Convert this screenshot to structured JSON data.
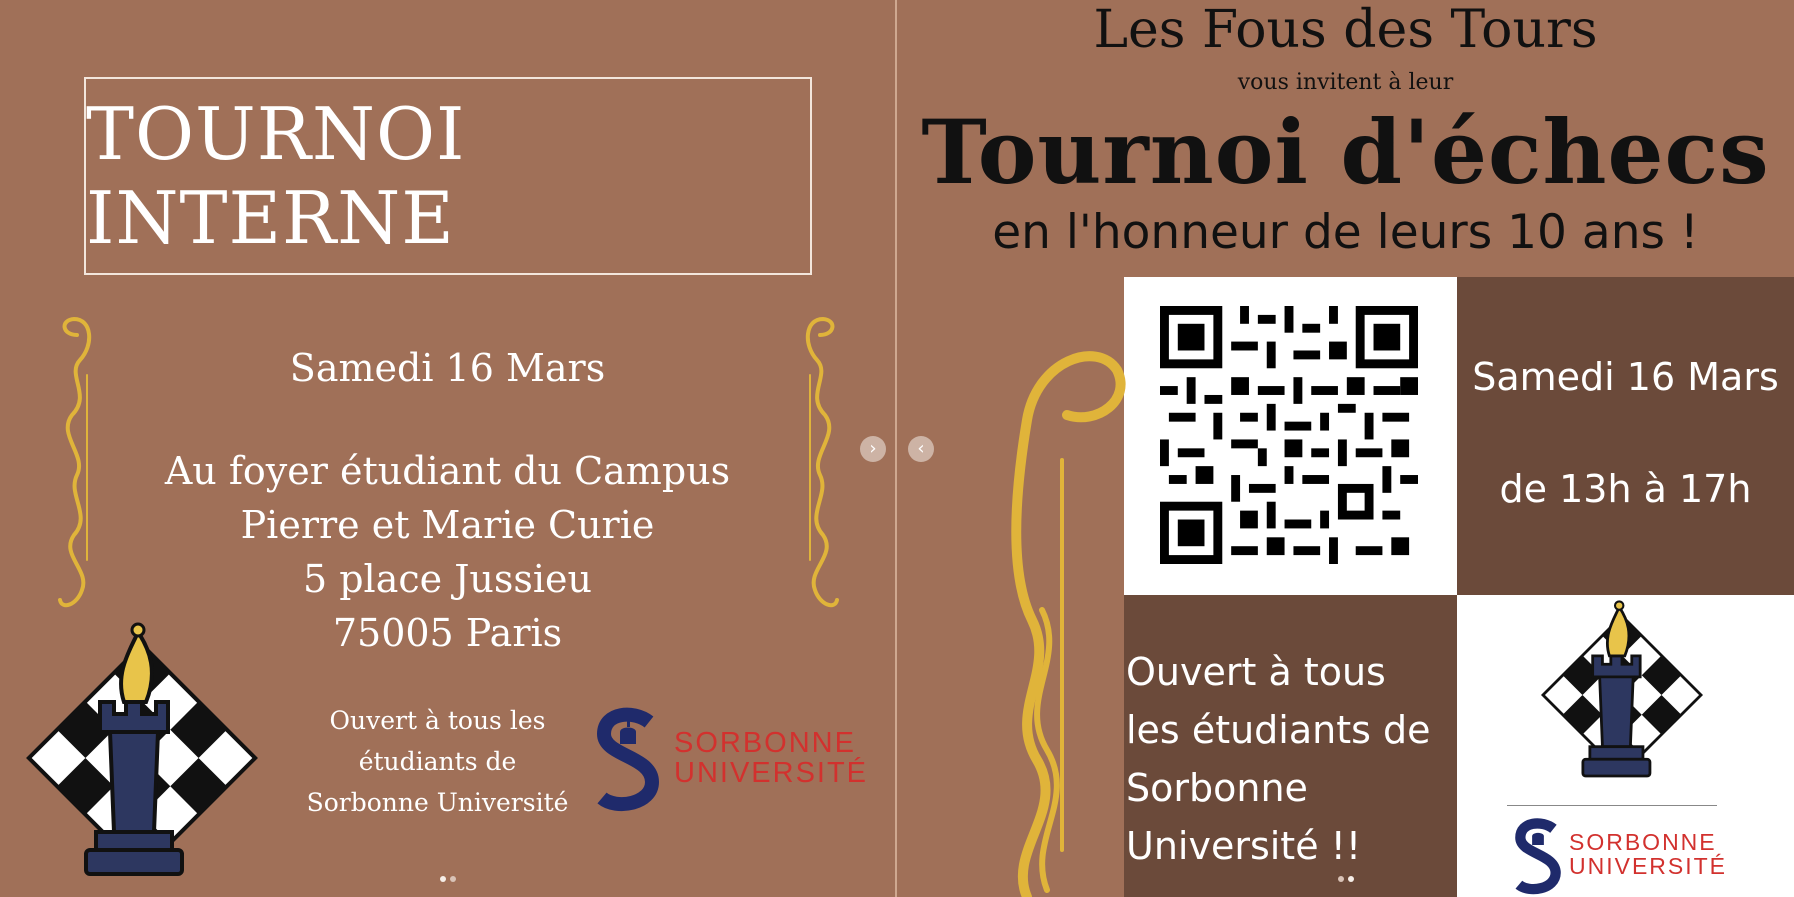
{
  "left": {
    "title": "TOURNOI INTERNE",
    "date": "Samedi 16 Mars",
    "address_lines": [
      "Au foyer étudiant du Campus",
      "Pierre et Marie Curie",
      "5 place Jussieu",
      "75005 Paris"
    ],
    "open_lines": [
      "Ouvert à tous les",
      "étudiants de",
      "Sorbonne Université"
    ],
    "logo_lines": [
      "SORBONNE",
      "UNIVERSITÉ"
    ]
  },
  "right": {
    "club": "Les Fous des Tours",
    "invite": "vous invitent à leur",
    "headline": "Tournoi d'échecs",
    "subtitle": "en l'honneur de leurs 10 ans !",
    "date": "Samedi 16 Mars",
    "time": "de 13h à 17h",
    "open_lines": [
      "Ouvert à tous",
      "les étudiants de",
      "Sorbonne",
      "Université !!"
    ],
    "logo_lines": [
      "SORBONNE",
      "UNIVERSITÉ"
    ]
  },
  "nav": {
    "next": "›",
    "prev": "‹"
  },
  "colors": {
    "background": "#a07058",
    "dark_brown": "#6b4a3a",
    "gold": "#e0b43a",
    "sorbonne_red": "#d2312e",
    "sorbonne_blue": "#1f2a6b"
  }
}
